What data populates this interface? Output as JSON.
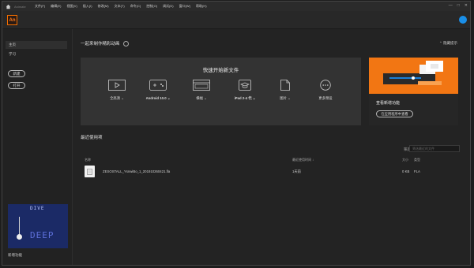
{
  "menubar": {
    "app_name": "Animate",
    "items": [
      "文件(F)",
      "编辑(E)",
      "视图(V)",
      "插入(I)",
      "修改(M)",
      "文本(T)",
      "命令(C)",
      "控制(O)",
      "调试(D)",
      "窗口(W)",
      "帮助(H)"
    ]
  },
  "logo": {
    "text": "An",
    "color": "#f26d00"
  },
  "sidebar": {
    "home": "主页",
    "learn": "学习",
    "new_button": "新建",
    "open_button": "打开",
    "promo_line1": "DIVE",
    "promo_line2": "DEEP",
    "new_features": "新增功能"
  },
  "main": {
    "section_title": "一起来制作精彩动画",
    "hide_tips": "隐藏提示",
    "quickstart_title": "快速开始新文件",
    "presets": [
      {
        "label": "全高清",
        "icon": "play-screen-icon"
      },
      {
        "label": "Android 10.0",
        "icon": "gamepad-icon"
      },
      {
        "label": "横幅",
        "icon": "browser-window-icon"
      },
      {
        "label": "iPad 2-4 代",
        "icon": "graduation-cap-icon"
      },
      {
        "label": "图片",
        "icon": "document-icon"
      },
      {
        "label": "更多预设",
        "icon": "more-dots-icon"
      }
    ],
    "learn_card": {
      "title": "查看新增功能",
      "button": "在应用程序中查看"
    },
    "recent_title": "最近使用项",
    "filter_label": "筛选",
    "filter_placeholder": "筛选最近的文件",
    "columns": {
      "name": "名称",
      "opened": "最近使用时间",
      "size": "大小",
      "type": "类型"
    },
    "recent_files": [
      {
        "name": "ZESOSTALL_YsnwiBo_1_201910260421.fla",
        "opened": "1天前",
        "size": "0 KB",
        "type": "FLA"
      }
    ]
  }
}
